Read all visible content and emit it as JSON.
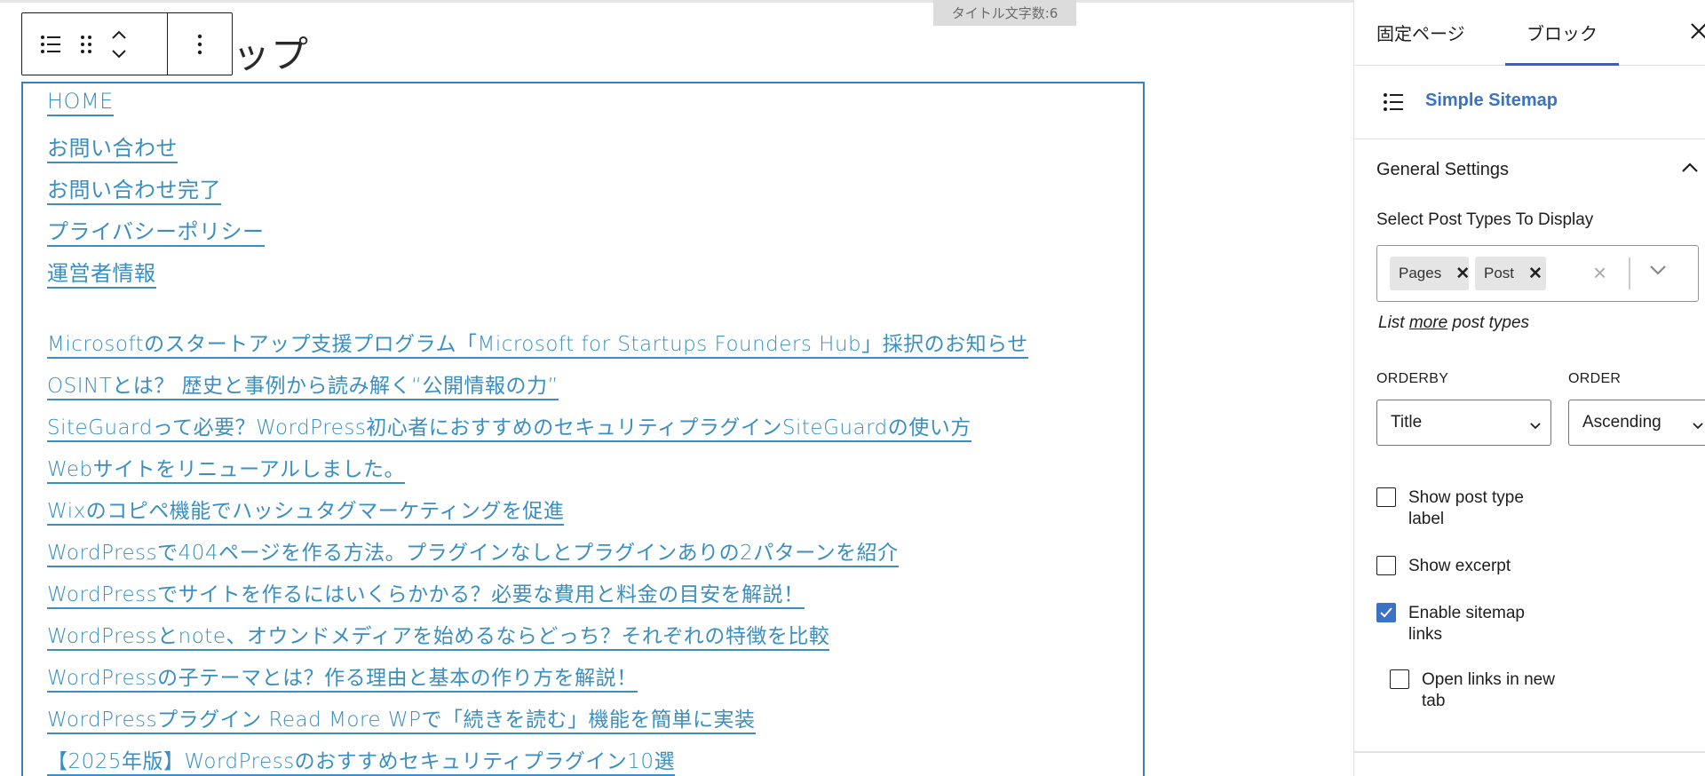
{
  "editor": {
    "title_counter": "タイトル文字数:6",
    "page_title_visible": "ップ",
    "toolbar": {
      "icons": [
        "list-icon",
        "drag-handle-icon",
        "chevron-up-icon",
        "chevron-down-icon",
        "more-options-icon"
      ]
    },
    "sitemap_links_pages": [
      "HOME",
      "お問い合わせ",
      "お問い合わせ完了",
      "プライバシーポリシー",
      "運営者情報"
    ],
    "sitemap_links_posts": [
      "Microsoftのスタートアップ支援プログラム「Microsoft for Startups Founders Hub」採択のお知らせ",
      "OSINTとは？ 歴史と事例から読み解く“公開情報の力”",
      "SiteGuardって必要？WordPress初心者におすすめのセキュリティプラグインSiteGuardの使い方",
      "Webサイトをリニューアルしました。",
      "Wixのコピペ機能でハッシュタグマーケティングを促進",
      "WordPressで404ページを作る方法。プラグインなしとプラグインありの2パターンを紹介",
      "WordPressでサイトを作るにはいくらかかる？必要な費用と料金の目安を解説！",
      "WordPressとnote、オウンドメディアを始めるならどっち？それぞれの特徴を比較",
      "WordPressの子テーマとは？作る理由と基本の作り方を解説！",
      "WordPressプラグイン Read More WPで「続きを読む」機能を簡単に実装",
      "【2025年版】WordPressのおすすめセキュリティプラグイン10選"
    ]
  },
  "sidebar": {
    "tabs": [
      "固定ページ",
      "ブロック"
    ],
    "active_tab": "ブロック",
    "block_name": "Simple Sitemap",
    "panel_title": "General Settings",
    "post_types_label": "Select Post Types To Display",
    "selected_post_types": [
      "Pages",
      "Post"
    ],
    "list_more": {
      "prefix": "List ",
      "link": "more",
      "suffix": " post types"
    },
    "orderby_label": "ORDERBY",
    "orderby_value": "Title",
    "order_label": "ORDER",
    "order_value": "Ascending",
    "checkboxes": [
      {
        "label": "Show post type label",
        "checked": false
      },
      {
        "label": "Show excerpt",
        "checked": false
      },
      {
        "label": "Enable sitemap links",
        "checked": true
      },
      {
        "label": "Open links in new tab",
        "checked": false
      }
    ]
  },
  "colors": {
    "link": "#3a8fc0",
    "block_border": "#3c7fb5",
    "accent": "#3a72c4",
    "tab_indicator": "#3858e9"
  }
}
